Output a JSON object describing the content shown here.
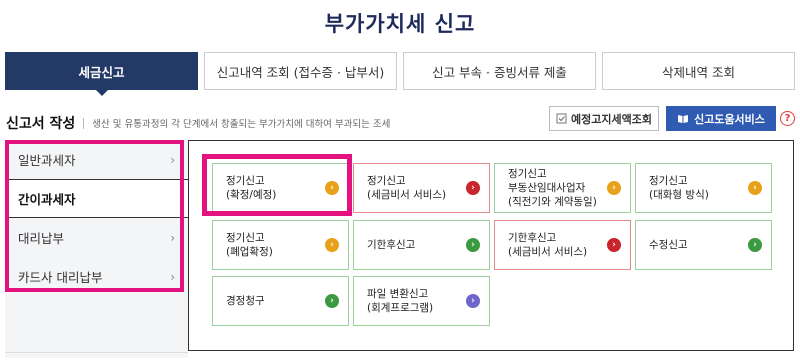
{
  "page": {
    "title": "부가가치세 신고"
  },
  "tabs": [
    {
      "label": "세금신고",
      "active": true
    },
    {
      "label": "신고내역 조회 (접수증 · 납부서)"
    },
    {
      "label": "신고 부속 · 증빙서류 제출"
    },
    {
      "label": "삭제내역 조회"
    }
  ],
  "section": {
    "title": "신고서 작성",
    "description": "생산 및 유통과정의 각 단계에서 창출되는 부가가치에 대하여 부과되는 조세"
  },
  "buttons": {
    "estimate": {
      "label": "예정고지세액조회",
      "icon": "document-check-icon"
    },
    "help": {
      "label": "신고도움서비스",
      "icon": "book-icon"
    },
    "question": "?"
  },
  "sidebar": {
    "items": [
      {
        "label": "일반과세자"
      },
      {
        "label": "간이과세자",
        "active": true
      },
      {
        "label": "대리납부"
      },
      {
        "label": "카드사 대리납부"
      }
    ],
    "chevron": "›"
  },
  "cards": [
    {
      "label": "정기신고\n(확정/예정)",
      "color": "orange"
    },
    {
      "label": "정기신고\n(세금비서 서비스)",
      "color": "red"
    },
    {
      "label": "정기신고\n부동산임대사업자\n(직전기와 계약동일)",
      "color": "orange"
    },
    {
      "label": "정기신고\n(대화형 방식)",
      "color": "orange"
    },
    {
      "label": "정기신고\n(폐업확정)",
      "color": "orange"
    },
    {
      "label": "기한후신고",
      "color": "green"
    },
    {
      "label": "기한후신고\n(세금비서 서비스)",
      "color": "red"
    },
    {
      "label": "수정신고",
      "color": "green"
    },
    {
      "label": "경정청구",
      "color": "green"
    },
    {
      "label": "파일 변환신고\n(회계프로그램)",
      "color": "purple"
    }
  ],
  "colors": {
    "primary": "#243a66",
    "help_button": "#2f5bb3",
    "highlight": "#e4127e",
    "orange": "#e8a11a",
    "red": "#c9252c",
    "green": "#3b9a3f",
    "purple": "#6f66c9"
  }
}
